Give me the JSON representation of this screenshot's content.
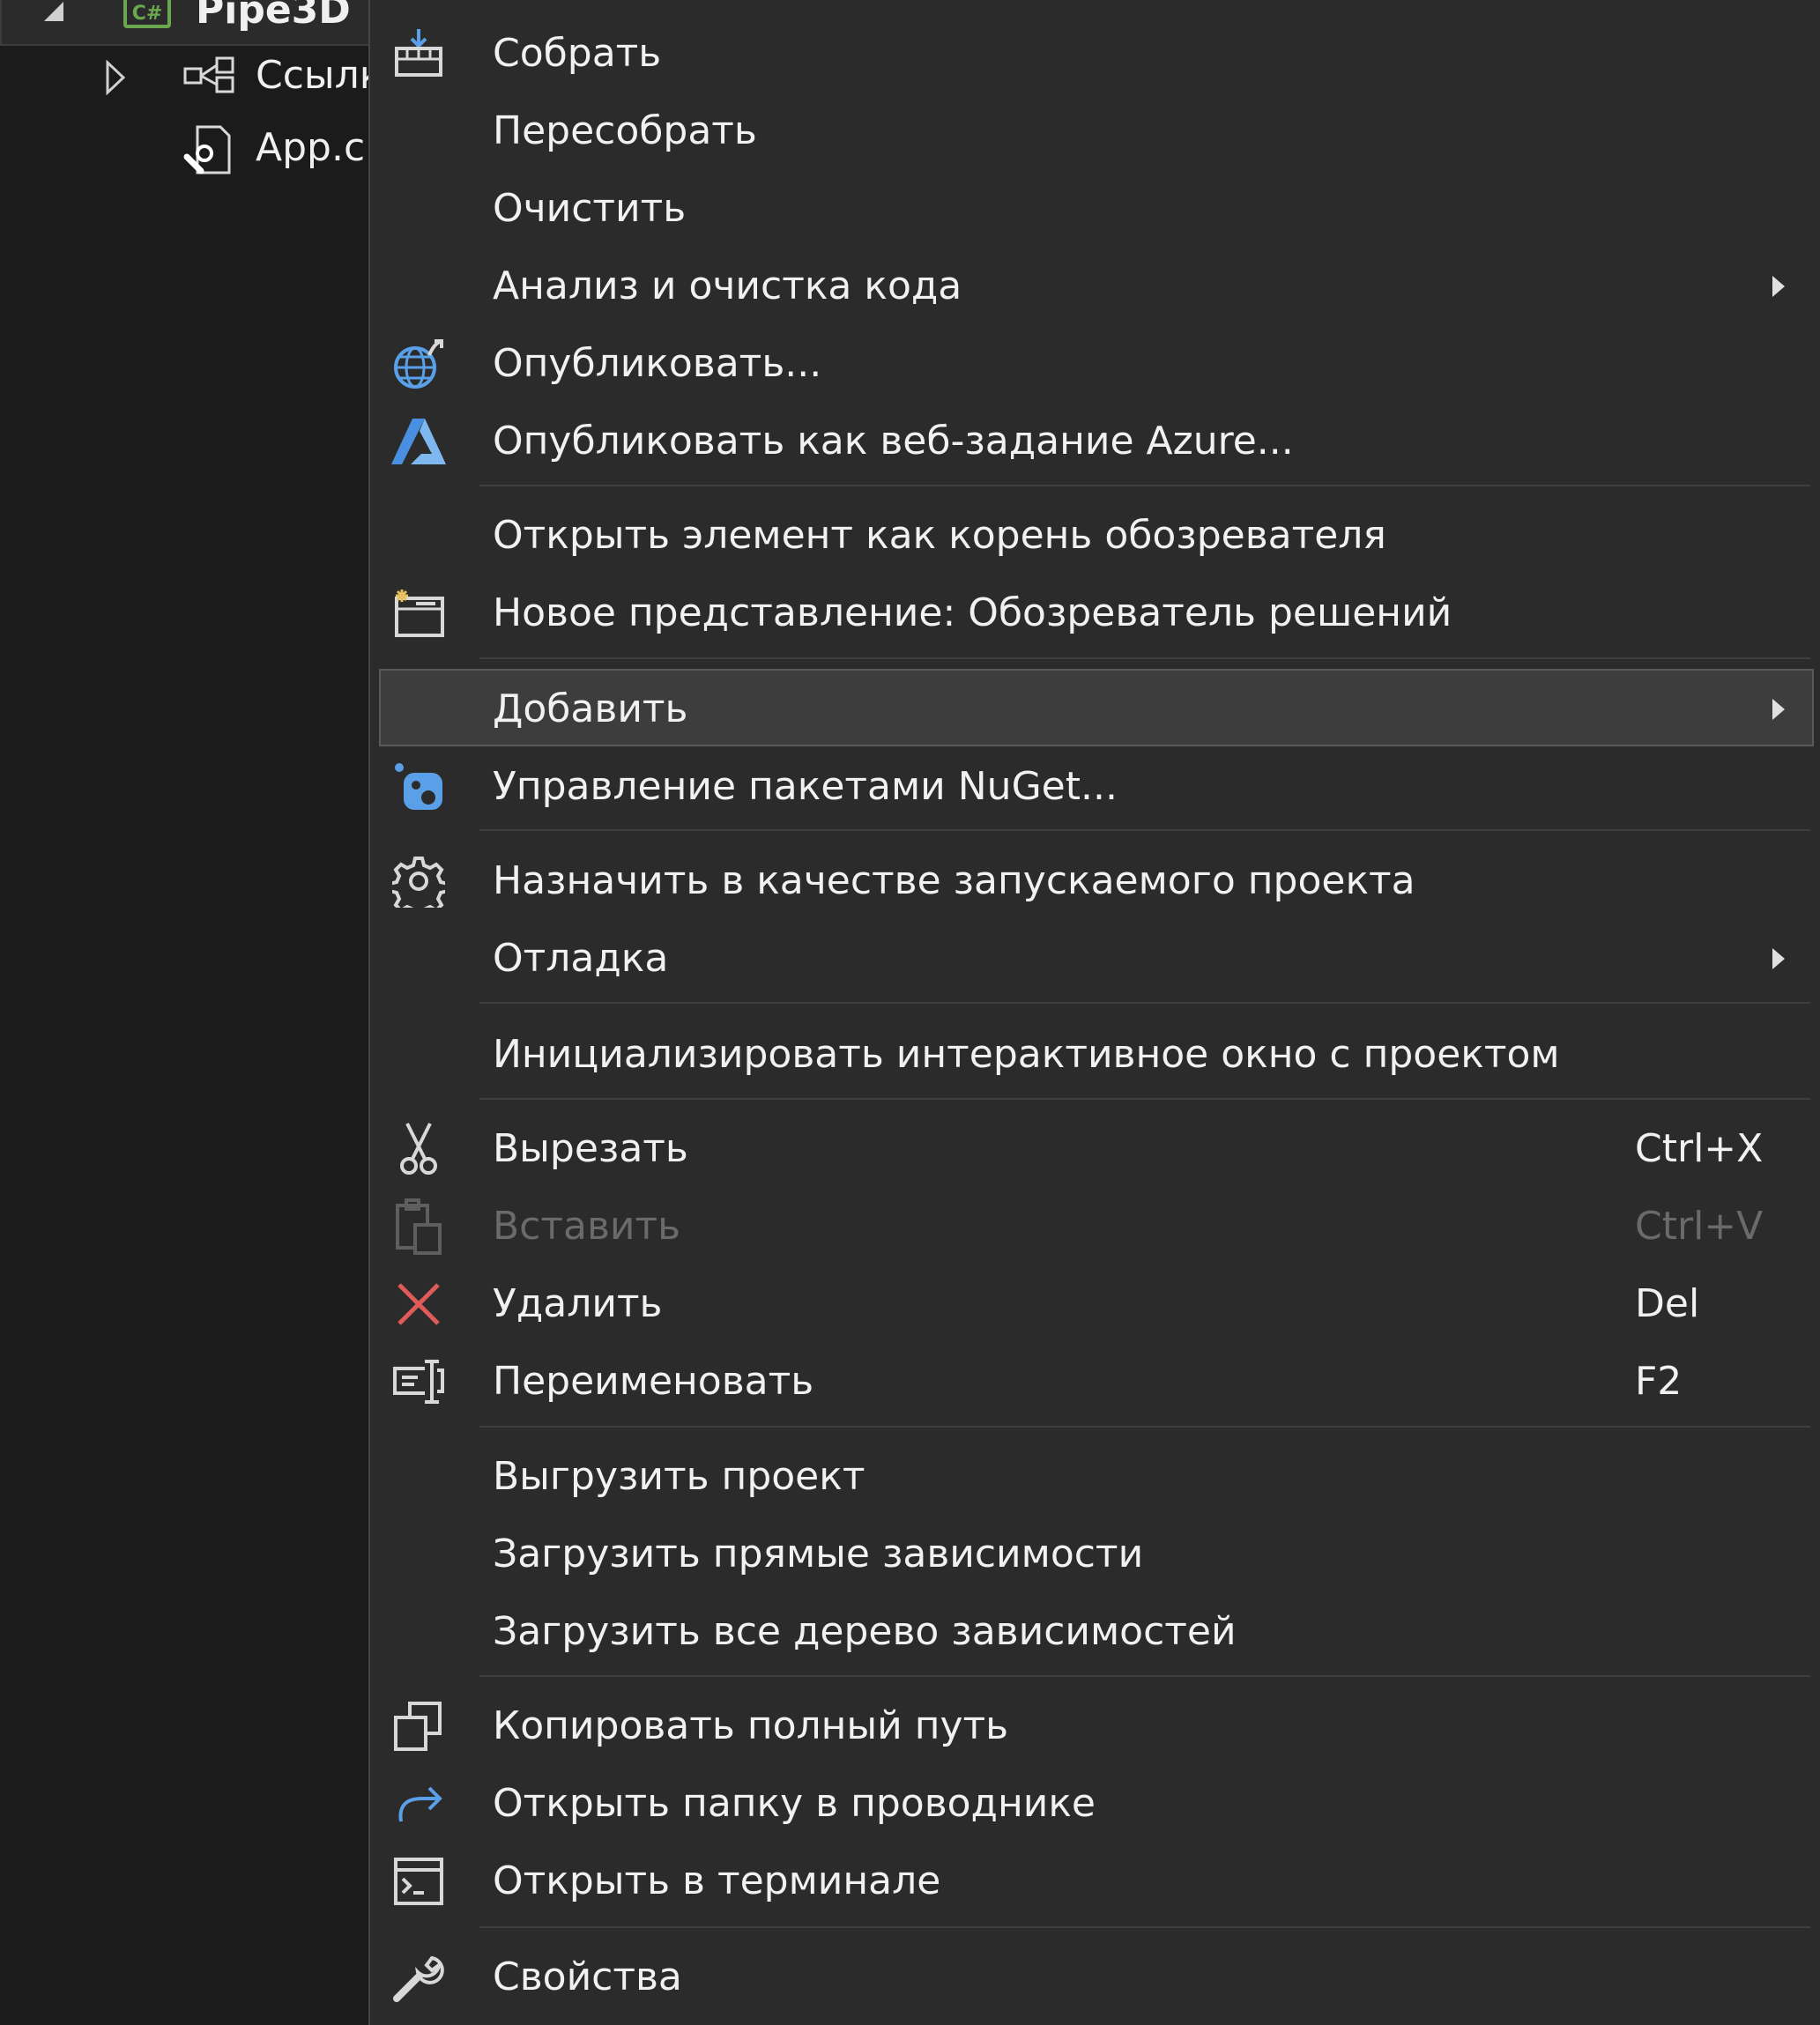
{
  "explorer": {
    "project": {
      "name": "Pipe3D",
      "lang_badge": "C#"
    },
    "items": [
      {
        "label": "Ссылк"
      },
      {
        "label": "App.c"
      }
    ]
  },
  "menu": {
    "items": [
      {
        "label": "Собрать",
        "icon": "build-icon"
      },
      {
        "label": "Пересобрать"
      },
      {
        "label": "Очистить"
      },
      {
        "label": "Анализ и очистка кода",
        "submenu": true
      },
      {
        "label": "Опубликовать...",
        "icon": "publish-globe-icon"
      },
      {
        "label": "Опубликовать как веб-задание Azure...",
        "icon": "azure-icon"
      },
      {
        "label": "Открыть элемент как корень обозревателя"
      },
      {
        "label": "Новое представление: Обозреватель решений",
        "icon": "new-view-icon"
      },
      {
        "label": "Добавить",
        "submenu": true,
        "highlighted": true
      },
      {
        "label": "Управление пакетами NuGet...",
        "icon": "nuget-icon"
      },
      {
        "label": "Назначить в качестве запускаемого проекта",
        "icon": "gear-icon"
      },
      {
        "label": "Отладка",
        "submenu": true
      },
      {
        "label": "Инициализировать интерактивное окно с проектом"
      },
      {
        "label": "Вырезать",
        "shortcut": "Ctrl+X",
        "icon": "scissors-icon"
      },
      {
        "label": "Вставить",
        "shortcut": "Ctrl+V",
        "icon": "paste-icon",
        "disabled": true
      },
      {
        "label": "Удалить",
        "shortcut": "Del",
        "icon": "delete-x-icon"
      },
      {
        "label": "Переименовать",
        "shortcut": "F2",
        "icon": "rename-icon"
      },
      {
        "label": "Выгрузить проект"
      },
      {
        "label": "Загрузить прямые зависимости"
      },
      {
        "label": "Загрузить все дерево зависимостей"
      },
      {
        "label": "Копировать полный путь",
        "icon": "copy-icon"
      },
      {
        "label": "Открыть папку в проводнике",
        "icon": "redo-arrow-icon"
      },
      {
        "label": "Открыть в терминале",
        "icon": "terminal-icon"
      },
      {
        "label": "Свойства",
        "icon": "wrench-icon"
      }
    ]
  },
  "colors": {
    "menu_bg": "#2b2b2b",
    "highlight_bg": "#3d3d3d",
    "text": "#f1f1f1",
    "disabled_text": "#6a6a6a",
    "icon_blue": "#5aa0e8",
    "delete_red": "#e05a5a"
  }
}
